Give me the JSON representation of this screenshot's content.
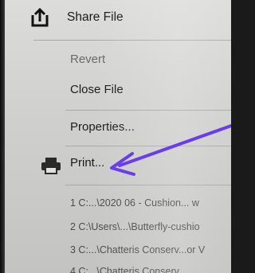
{
  "menu": {
    "share": {
      "label": "Share File",
      "icon": "share-icon"
    },
    "revert": {
      "label": "Revert"
    },
    "close": {
      "label": "Close File"
    },
    "properties": {
      "label": "Properties..."
    },
    "print": {
      "label": "Print...",
      "icon": "printer-icon"
    }
  },
  "recent_files": [
    {
      "label": "1 C:...\\2020 06 - Cushion... w"
    },
    {
      "label": "2 C:\\Users\\...\\Butterfly-cushio"
    },
    {
      "label": "3 C:...\\Chatteris Conserv...or V"
    },
    {
      "label": "4 C:...\\Chatteris Conserv..."
    }
  ],
  "annotation": {
    "arrow_color": "#6a3cf0"
  },
  "colors": {
    "menu_bg": "#d3d4d1",
    "text": "#1c1c1c",
    "dim_text": "#6a6a6a"
  }
}
